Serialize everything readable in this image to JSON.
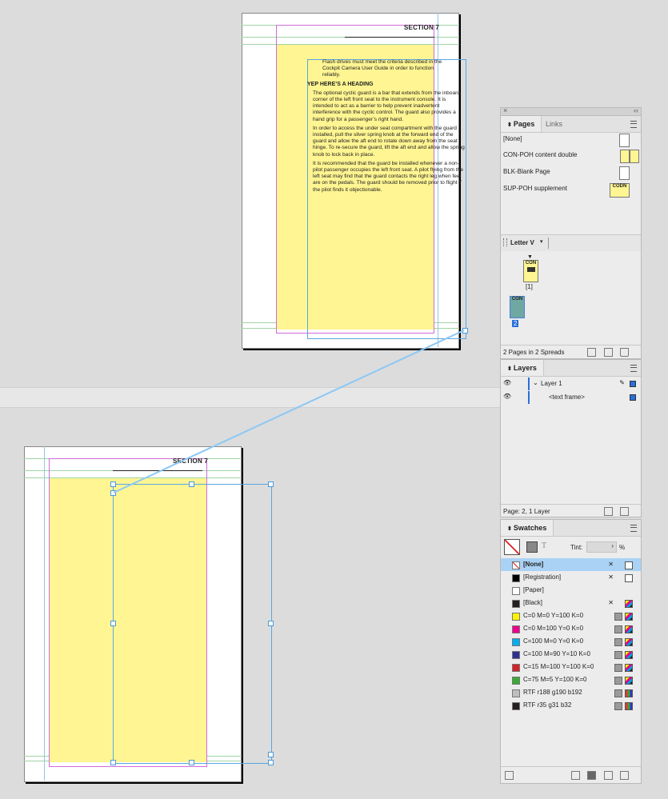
{
  "document": {
    "section_head": "SECTION 7",
    "flash_text": "Flash drives must meet the criteria described in the Cockpit Camera User Guide in order to function reliably.",
    "heading": "YEP HERE’S A HEADING",
    "paragraphs": [
      "The optional cyclic guard is a bar that extends from the inboard corner of the left front seat to the instrument console. It is intended to act as a barrier to help prevent inadvertent interference with the cyclic control. The guard also provides a hand grip for a passenger’s right hand.",
      "In order to access the under seat compartment with the guard installed, pull the silver spring knob at the forward end of the guard and allow the aft end to rotate down away from the seat hinge. To re-secure the guard, lift the aft end and allow the spring knob to lock back in place.",
      "It is recommended that the guard be installed whenever a non-pilot passenger occupies the left front seat. A pilot flying from the left seat may find that the guard contacts the right leg when feet are on the pedals. The guard should be removed prior to flight if the pilot finds it objectionable."
    ],
    "lower_section_head": "SECTION 7",
    "colors": {
      "page_yellow": "#fff592",
      "margin_guide": "#d36bd8",
      "frame": "#5aa6e0",
      "thread": "#8cc8f5"
    }
  },
  "pages_panel": {
    "tabs": [
      "Pages",
      "Links"
    ],
    "masters": [
      {
        "label": "[None]"
      },
      {
        "label": "CON-POH content double"
      },
      {
        "label": "BLK-Blank Page"
      },
      {
        "label": "SUP-POH supplement",
        "thumb_text": "CODN"
      }
    ],
    "size_label": "Letter V",
    "page_thumbs": [
      {
        "thumb_text": "CON",
        "number": "[1]"
      },
      {
        "thumb_text": "CON",
        "number": "2"
      }
    ],
    "footer": "2 Pages in 2 Spreads"
  },
  "layers_panel": {
    "title": "Layers",
    "layers": [
      {
        "label": "Layer 1"
      },
      {
        "label": "<text frame>"
      }
    ],
    "footer": "Page: 2, 1 Layer",
    "layer_color": "#2a6fdb"
  },
  "swatches_panel": {
    "title": "Swatches",
    "tint_label": "Tint:",
    "tint_value": "",
    "percent": "%",
    "swatches": [
      {
        "name": "[None]",
        "color": "none",
        "selected": true
      },
      {
        "name": "[Registration]",
        "color": "#000000"
      },
      {
        "name": "[Paper]",
        "color": "#ffffff"
      },
      {
        "name": "[Black]",
        "color": "#231f20"
      },
      {
        "name": "C=0 M=0 Y=100 K=0",
        "color": "#fff200"
      },
      {
        "name": "C=0 M=100 Y=0 K=0",
        "color": "#ec008c"
      },
      {
        "name": "C=100 M=0 Y=0 K=0",
        "color": "#00aeef"
      },
      {
        "name": "C=100 M=90 Y=10 K=0",
        "color": "#2e3192"
      },
      {
        "name": "C=15 M=100 Y=100 K=0",
        "color": "#d2232a"
      },
      {
        "name": "C=75 M=5 Y=100 K=0",
        "color": "#3aaa35"
      },
      {
        "name": "RTF r188 g190 b192",
        "color": "#bcbec0"
      },
      {
        "name": "RTF r35 g31 b32",
        "color": "#231f20"
      }
    ]
  }
}
